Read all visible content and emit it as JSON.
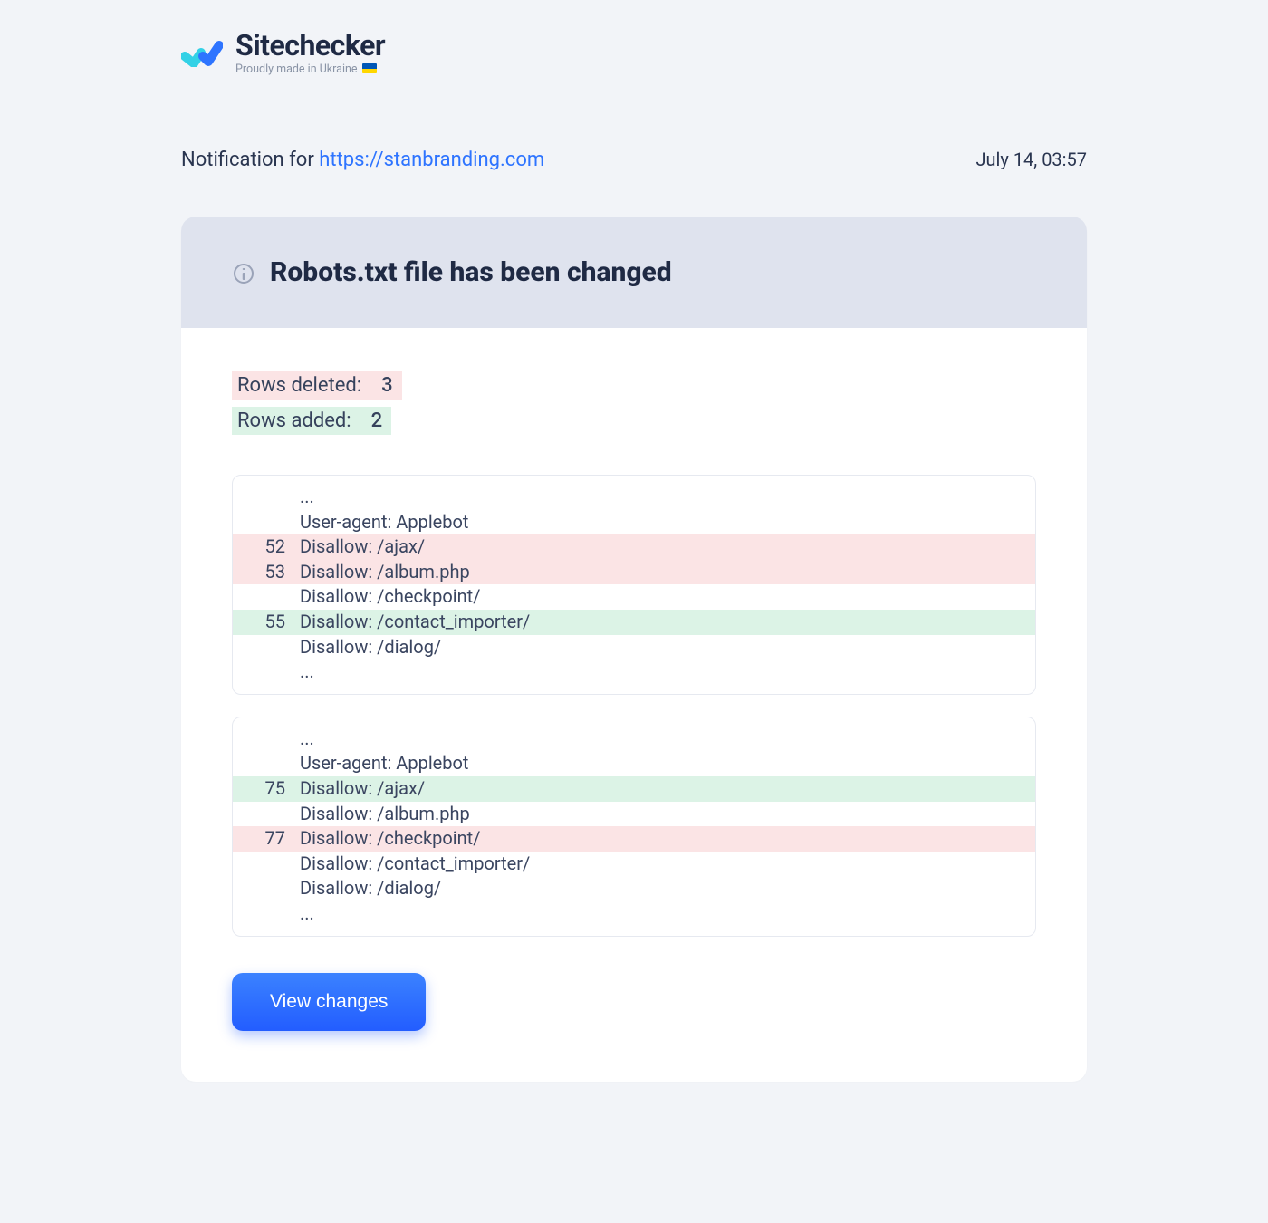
{
  "logo": {
    "brand": "Sitechecker",
    "tagline": "Proudly made in Ukraine"
  },
  "header": {
    "notification_prefix": "Notification for ",
    "site_url": "https://stanbranding.com",
    "date": "July 14, 03:57"
  },
  "card": {
    "title": "Robots.txt file has been changed",
    "stats": {
      "deleted_label": "Rows deleted:",
      "deleted_count": "3",
      "added_label": "Rows added:",
      "added_count": "2"
    },
    "diff1": [
      {
        "ln": "",
        "txt": "...",
        "type": ""
      },
      {
        "ln": "",
        "txt": "User-agent: Applebot",
        "type": ""
      },
      {
        "ln": "52",
        "txt": "Disallow: /ajax/",
        "type": "deleted"
      },
      {
        "ln": "53",
        "txt": "Disallow: /album.php",
        "type": "deleted"
      },
      {
        "ln": "",
        "txt": "Disallow: /checkpoint/",
        "type": ""
      },
      {
        "ln": "55",
        "txt": "Disallow: /contact_importer/",
        "type": "added"
      },
      {
        "ln": "",
        "txt": "Disallow: /dialog/",
        "type": ""
      },
      {
        "ln": "",
        "txt": "...",
        "type": ""
      }
    ],
    "diff2": [
      {
        "ln": "",
        "txt": "...",
        "type": ""
      },
      {
        "ln": "",
        "txt": "User-agent: Applebot",
        "type": ""
      },
      {
        "ln": "75",
        "txt": "Disallow: /ajax/",
        "type": "added"
      },
      {
        "ln": "",
        "txt": "Disallow: /album.php",
        "type": ""
      },
      {
        "ln": "77",
        "txt": "Disallow: /checkpoint/",
        "type": "deleted"
      },
      {
        "ln": "",
        "txt": "Disallow: /contact_importer/",
        "type": ""
      },
      {
        "ln": "",
        "txt": "Disallow: /dialog/",
        "type": ""
      },
      {
        "ln": "",
        "txt": "...",
        "type": ""
      }
    ],
    "button_label": "View changes"
  }
}
